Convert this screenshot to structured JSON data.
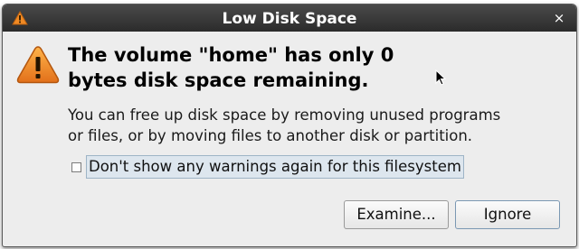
{
  "window": {
    "title": "Low Disk Space",
    "close_glyph": "×",
    "title_icon": "warning-icon"
  },
  "dialog": {
    "icon": "warning-icon",
    "headline_line1": "The volume \"home\" has only 0",
    "headline_line2": "bytes disk space remaining.",
    "body_line1": "You can free up disk space by removing unused programs",
    "body_line2": "or files, or by moving files to another disk or partition.",
    "checkbox_label": "Don't show any warnings again for this filesystem",
    "checkbox_checked": false
  },
  "buttons": {
    "examine_label": "Examine...",
    "ignore_label": "Ignore"
  },
  "colors": {
    "warning_orange": "#f08a24",
    "titlebar": "#2b2b2b",
    "focus_border": "#9eb4c6"
  }
}
